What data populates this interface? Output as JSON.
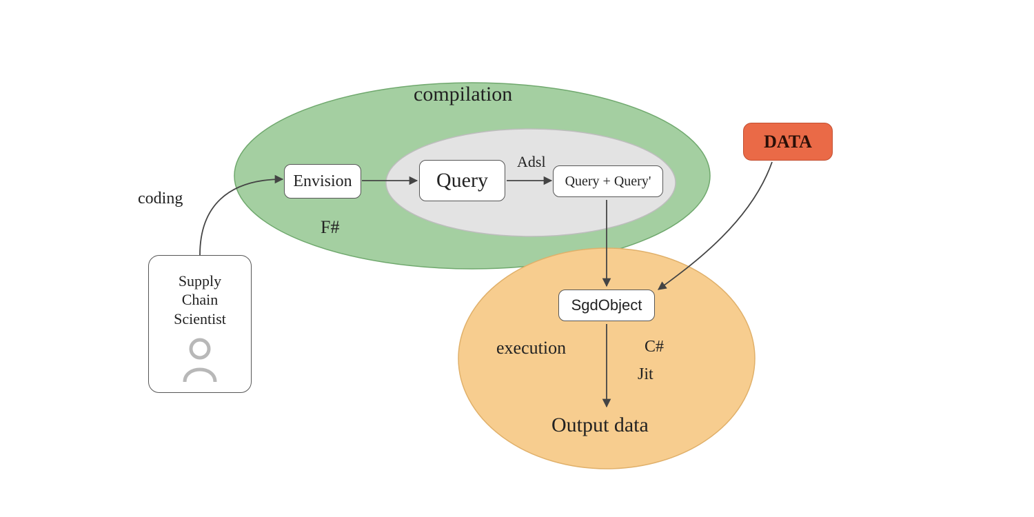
{
  "actor": {
    "title": "Supply\nChain\nScientist"
  },
  "edges": {
    "coding": "coding",
    "adsl": "Adsl"
  },
  "compilation": {
    "title": "compilation",
    "lang": "F#",
    "envision": "Envision",
    "query": "Query",
    "query_prime": "Query + Query'"
  },
  "data_node": "DATA",
  "execution": {
    "sgd": "SgdObject",
    "title": "execution",
    "lang": "C#",
    "jit": "Jit",
    "output": "Output data"
  },
  "colors": {
    "green": "#a4cfa1",
    "grey": "#e3e3e3",
    "orange": "#f7cd8f",
    "red": "#ea6a47"
  }
}
